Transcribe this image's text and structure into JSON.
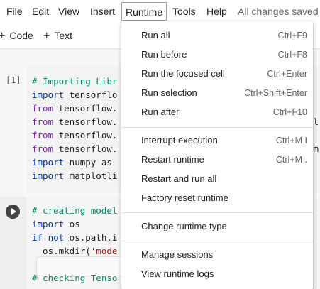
{
  "menubar": {
    "items": [
      "File",
      "Edit",
      "View",
      "Insert",
      "Runtime",
      "Tools",
      "Help"
    ],
    "saved_status": "All changes saved"
  },
  "toolbar": {
    "code_label": "Code",
    "text_label": "Text"
  },
  "cells": [
    {
      "exec_count": "[1]",
      "lines": [
        {
          "t": "# Importing Libr",
          "c": "comment"
        },
        {
          "t": "import tensorflo",
          "kw": "import",
          "rest": " tensorflo"
        },
        {
          "t": "from tensorflow.",
          "kw": "from",
          "rest": " tensorflow."
        },
        {
          "t": "from tensorflow.",
          "kw": "from",
          "rest": " tensorflow."
        },
        {
          "t": "from tensorflow.",
          "kw": "from",
          "rest": " tensorflow."
        },
        {
          "t": "from tensorflow.",
          "kw": "from",
          "rest": " tensorflow."
        },
        {
          "t": "import numpy as",
          "kw": "import",
          "rest": " numpy as"
        },
        {
          "t": "import matplotli",
          "kw": "import",
          "rest": " matplotli"
        }
      ],
      "overflow_fragments": [
        "ol",
        "Im"
      ]
    },
    {
      "lines": [
        {
          "t": "# creating model",
          "c": "comment"
        },
        {
          "t": "import os",
          "kw": "import",
          "rest": " os"
        },
        {
          "t": "if not os.path.i",
          "kw": "if not",
          "rest": " os.path.i"
        },
        {
          "t": "  os.mkdir('mode",
          "plain": "  os.mkdir(",
          "str": "'mode"
        },
        {
          "t": "",
          "c": "plain"
        },
        {
          "t": "# checking Tenso",
          "c": "comment"
        }
      ]
    }
  ],
  "runtime_menu": {
    "groups": [
      [
        {
          "label": "Run all",
          "shortcut": "Ctrl+F9"
        },
        {
          "label": "Run before",
          "shortcut": "Ctrl+F8"
        },
        {
          "label": "Run the focused cell",
          "shortcut": "Ctrl+Enter"
        },
        {
          "label": "Run selection",
          "shortcut": "Ctrl+Shift+Enter"
        },
        {
          "label": "Run after",
          "shortcut": "Ctrl+F10"
        }
      ],
      [
        {
          "label": "Interrupt execution",
          "shortcut": "Ctrl+M I"
        },
        {
          "label": "Restart runtime",
          "shortcut": "Ctrl+M ."
        },
        {
          "label": "Restart and run all",
          "shortcut": ""
        },
        {
          "label": "Factory reset runtime",
          "shortcut": ""
        }
      ],
      [
        {
          "label": "Change runtime type",
          "shortcut": ""
        }
      ],
      [
        {
          "label": "Manage sessions",
          "shortcut": ""
        },
        {
          "label": "View runtime logs",
          "shortcut": ""
        }
      ]
    ]
  }
}
